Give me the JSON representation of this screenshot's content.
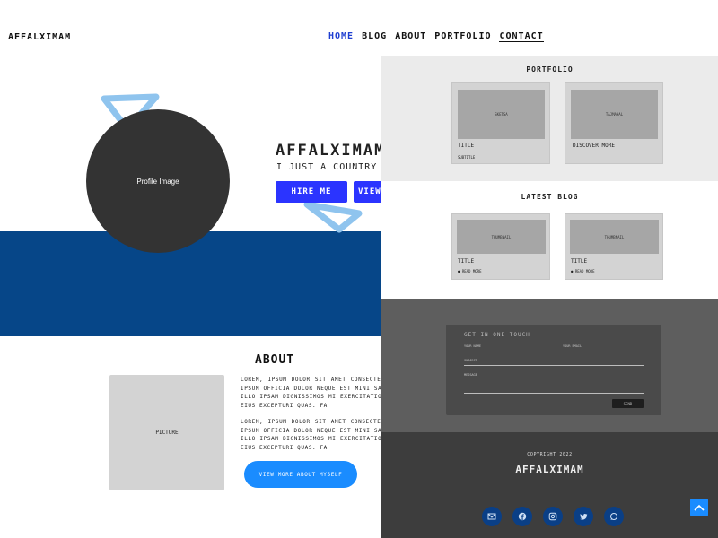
{
  "header": {
    "brand": "AFFALXIMAM",
    "nav": [
      "HOME",
      "BLOG",
      "ABOUT",
      "PORTFOLIO",
      "CONTACT"
    ]
  },
  "hero": {
    "profile_label": "Profile Image",
    "name": "AFFALXIMAM",
    "tagline": "I JUST A COUNTRY PE",
    "hire_button": "HIRE ME",
    "view_button": "VIEW"
  },
  "about": {
    "title": "ABOUT",
    "picture_label": "PICTURE",
    "paragraphs": [
      "LOREM, IPSUM DOLOR SIT AMET CONSECTE ID IPSUM OFFICIA DOLOR NEQUE EST MINI SAEPE ILLO IPSAM DIGNISSIMOS MI EXERCITATIONEM EIUS EXCEPTURI QUAS. FA",
      "LOREM, IPSUM DOLOR SIT AMET CONSECTE ID IPSUM OFFICIA DOLOR NEQUE EST MINI SAEPE ILLO IPSAM DIGNISSIMOS MI EXERCITATIONEM EIUS EXCEPTURI QUAS. FA"
    ],
    "more_button": "VIEW MORE ABOUT MYSELF"
  },
  "portfolio": {
    "title": "PORTFOLIO",
    "cards": [
      {
        "thumb": "SKETSA",
        "title": "TITLE",
        "sub": "SUBTITLE"
      },
      {
        "thumb": "TAJMAHAL",
        "title": "DISCOVER MORE",
        "sub": ""
      }
    ]
  },
  "blog": {
    "title": "LATEST BLOG",
    "cards": [
      {
        "thumb": "THUMBNAIL",
        "title": "TITLE",
        "meta": "READ MORE"
      },
      {
        "thumb": "THUMBNAIL",
        "title": "TITLE",
        "meta": "READ MORE"
      }
    ]
  },
  "contact": {
    "title": "GET IN ONE TOUCH",
    "fields": [
      "YOUR NAME",
      "YOUR EMAIL",
      "SUBJECT",
      "MESSAGE"
    ],
    "send": "SEND"
  },
  "footer": {
    "copyright": "COPYRIGHT 2022",
    "brand": "AFFALXIMAM",
    "socials": [
      "email-icon",
      "facebook-icon",
      "instagram-icon",
      "twitter-icon",
      "whatsapp-icon"
    ]
  },
  "colors": {
    "accent_blue": "#2b34ff",
    "hero_band": "#064688",
    "button_blue": "#1a8cff",
    "social_blue": "#0a3f86"
  }
}
